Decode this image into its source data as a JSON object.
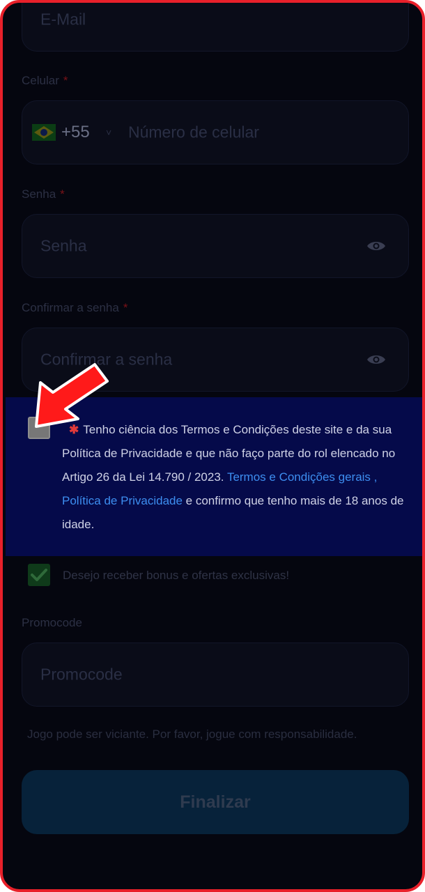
{
  "form": {
    "email": {
      "placeholder": "E-Mail"
    },
    "phone": {
      "label": "Celular",
      "required_mark": "*",
      "country_code": "+55",
      "placeholder": "Número de celular"
    },
    "password": {
      "label": "Senha",
      "required_mark": "*",
      "placeholder": "Senha"
    },
    "confirm_password": {
      "label": "Confirmar a senha",
      "required_mark": "*",
      "placeholder": "Confirmar a senha"
    },
    "terms": {
      "required_mark": "✱",
      "text": "Tenho ciência dos Termos e Condições deste site e da sua Política de Privacidade e que não faço parte do rol elencado no Artigo 26 da Lei 14.790 / 2023. ",
      "link1": "Termos e Condições gerais",
      "separator": " , ",
      "link2": "Política de Privacidade",
      "tail": " e confirmo que tenho mais de 18 anos de idade.",
      "checked": false
    },
    "offers": {
      "label": "Desejo receber bonus e ofertas exclusivas!",
      "checked": true
    },
    "promocode": {
      "label": "Promocode",
      "placeholder": "Promocode"
    },
    "disclaimer": "Jogo pode ser viciante. Por favor, jogue com responsabilidade.",
    "submit_label": "Finalizar"
  },
  "colors": {
    "frame_border": "#e8202a",
    "background": "#05060f",
    "consent_highlight": "#050a4a",
    "link": "#3d8ef0",
    "arrow": "#ff1a1a"
  },
  "icons": [
    "brazil-flag-icon",
    "eye-icon",
    "check-icon",
    "pointer-arrow-icon"
  ]
}
